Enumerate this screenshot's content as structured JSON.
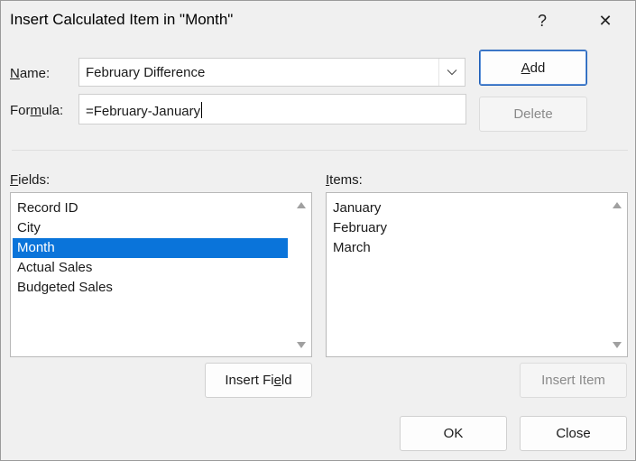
{
  "dialog": {
    "title": "Insert Calculated Item in \"Month\"",
    "help_label": "?",
    "close_glyph": "✕"
  },
  "name": {
    "label_accel": "N",
    "label_rest": "ame:",
    "value": "February Difference"
  },
  "formula": {
    "label_pre": "For",
    "label_accel": "m",
    "label_post": "ula:",
    "value": "=February-January"
  },
  "buttons": {
    "add_accel": "A",
    "add_rest": "dd",
    "delete": "Delete",
    "insert_field_pre": "Insert Fi",
    "insert_field_accel": "e",
    "insert_field_post": "ld",
    "insert_item": "Insert Item",
    "ok": "OK",
    "close": "Close"
  },
  "fields": {
    "label_accel": "F",
    "label_rest": "ields:",
    "items": [
      "Record ID",
      "City",
      "Month",
      "Actual Sales",
      "Budgeted Sales"
    ],
    "selected": "Month"
  },
  "items": {
    "label_accel": "I",
    "label_rest": "tems:",
    "items": [
      "January",
      "February",
      "March"
    ]
  },
  "icons": {
    "dropdown": "chevron-down-icon",
    "scroll_up": "scroll-up-arrow-icon",
    "scroll_down": "scroll-down-arrow-icon"
  },
  "colors": {
    "selection": "#0a74da",
    "default_button_border": "#1f5fb8"
  }
}
